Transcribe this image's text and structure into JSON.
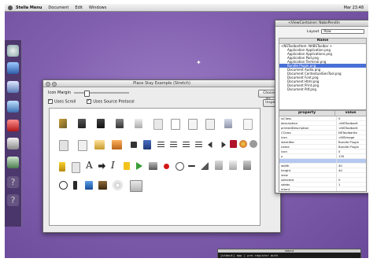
{
  "menubar": {
    "app_name": "Stella Menu",
    "items": [
      "Document",
      "Edit",
      "Windows"
    ],
    "clock": "Mar 23:48"
  },
  "main_window": {
    "title": "Place Stay Example (Stretch)",
    "icon_margin_label": "Icon Margin",
    "icon_margin_value": 0.2,
    "uses_scroll_label": "Uses Scroll",
    "uses_scroll_checked": true,
    "uses_source_protocol_label": "Uses Source Protocol",
    "uses_source_protocol_checked": true,
    "choose_button": "Choose dir...",
    "inspect_button": "Inspect"
  },
  "inspector": {
    "title": "<ViewContainer: NabsPendin",
    "layout_label": "Layout",
    "layout_value": "Row",
    "outline_header": "Name",
    "outline_rows": [
      "<NSToolbarItem: NABSToolbar >",
      "Application Application.png",
      "Application Applications.png",
      "Application Pad.png",
      "Application Terminal.png",
      "Bundle Plugin.png",
      "Document Audio.png",
      "Document ContextualGenTool.png",
      "Document Font.png",
      "Document Html.png",
      "Document Print.png",
      "Document Pdf.png"
    ],
    "selected_outline_index": 5,
    "property_header": "property",
    "value_header": "value",
    "properties": [
      [
        "isClass",
        "0"
      ],
      [
        "description",
        "<NSToolbarIt"
      ],
      [
        "printedDescription",
        "<NSToolbarIt"
      ],
      [
        "CClass",
        "NSToolbarIte"
      ],
      [
        "icon",
        "<NSImage"
      ],
      [
        "identifier",
        "Bundle Plugin"
      ],
      [
        "name",
        "Bundle Plugin"
      ],
      [
        "icon",
        "0"
      ],
      [
        "x",
        "130"
      ],
      [
        "",
        ""
      ],
      [
        "width",
        "40"
      ],
      [
        "height",
        "40"
      ],
      [
        "view",
        ""
      ],
      [
        "selected",
        "0"
      ],
      [
        "sdebs",
        "1"
      ],
      [
        "intent",
        ""
      ]
    ],
    "selected_property_index": 9
  },
  "console": {
    "title": "stdout",
    "text": "[stdout] app | pre-register auth"
  }
}
